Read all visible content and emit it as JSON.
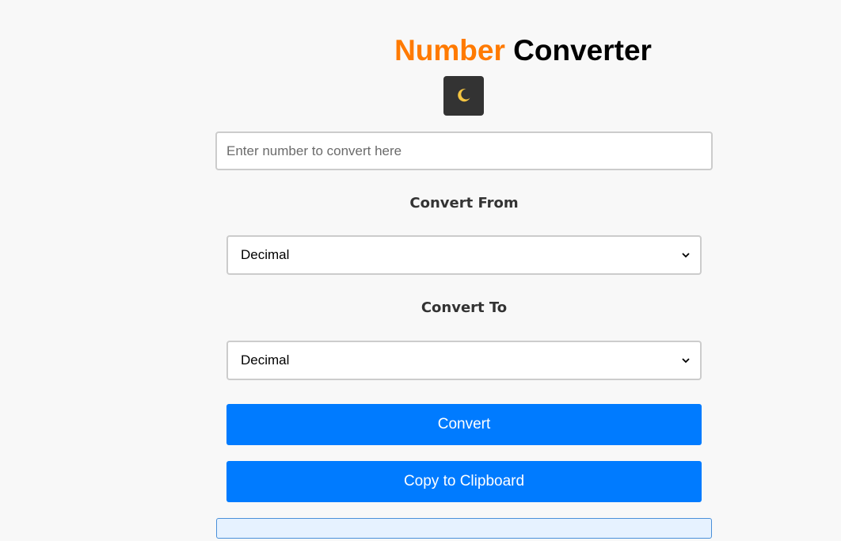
{
  "header": {
    "title_word1": "Number",
    "title_word2": "Converter",
    "title_word1_color": "#ff7a00"
  },
  "theme_toggle": {
    "icon": "crescent-moon-icon",
    "glyph": "🌙"
  },
  "number_input": {
    "value": "",
    "placeholder": "Enter number to convert here"
  },
  "convert_from": {
    "label": "Convert From",
    "selected": "Decimal"
  },
  "convert_to": {
    "label": "Convert To",
    "selected": "Decimal"
  },
  "buttons": {
    "convert_label": "Convert",
    "copy_label": "Copy to Clipboard",
    "color": "#007bff"
  },
  "result": {
    "value": ""
  }
}
